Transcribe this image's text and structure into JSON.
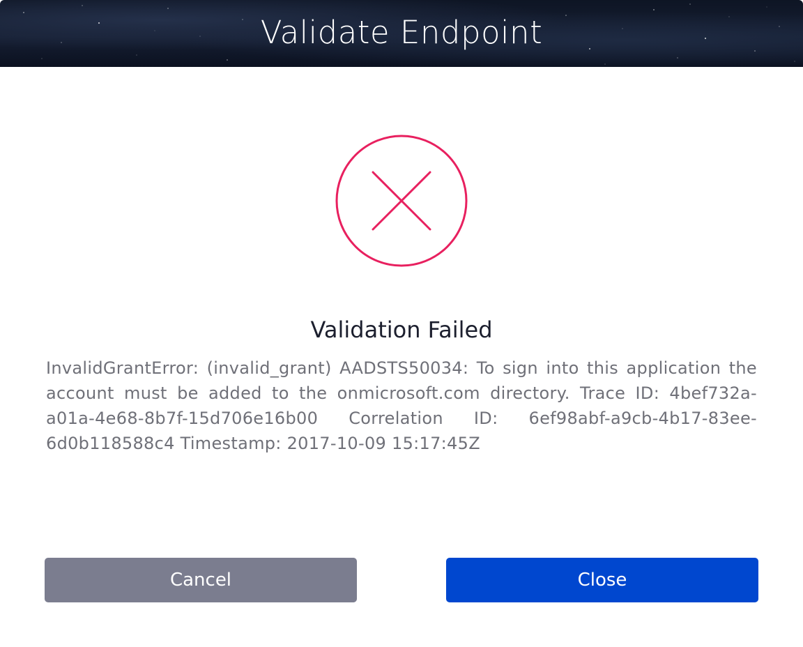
{
  "dialog": {
    "title": "Validate Endpoint",
    "status_icon": "error-x-circle-icon",
    "status_title": "Validation Failed",
    "message": "InvalidGrantError: (invalid_grant) AADSTS50034: To sign into this application the account must be added to the onmicrosoft.com directory.  Trace ID: 4bef732a-a01a-4e68-8b7f-15d706e16b00 Correlation ID: 6ef98abf-a9cb-4b17-83ee-6d0b118588c4 Timestamp: 2017-10-09 15:17:45Z",
    "buttons": {
      "cancel_label": "Cancel",
      "close_label": "Close"
    }
  },
  "colors": {
    "error_accent": "#e8205f",
    "primary_button": "#0047cf",
    "secondary_button": "#7b7d8f",
    "message_text": "#6f7078",
    "title_text": "#1c1f2e"
  }
}
